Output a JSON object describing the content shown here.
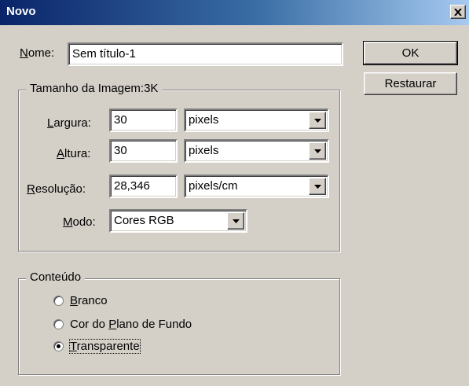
{
  "window": {
    "title": "Novo",
    "close_label": "close"
  },
  "name": {
    "label_pre": "",
    "label_u": "N",
    "label_rest": "ome:",
    "value": "Sem título-1"
  },
  "image_size": {
    "legend": "Tamanho da Imagem:3K",
    "width": {
      "label_u": "L",
      "label_rest": "argura:",
      "value": "30",
      "unit": "pixels"
    },
    "height": {
      "label_u": "A",
      "label_rest": "ltura:",
      "value": "30",
      "unit": "pixels"
    },
    "resolution": {
      "label_u": "R",
      "label_rest": "esolução:",
      "value": "28,346",
      "unit": "pixels/cm"
    },
    "mode": {
      "label_u": "M",
      "label_rest": "odo:",
      "value": "Cores RGB"
    }
  },
  "content": {
    "legend": "Conteúdo",
    "options": [
      {
        "pre": "",
        "u": "B",
        "rest": "ranco",
        "selected": false
      },
      {
        "pre": "Cor do ",
        "u": "P",
        "rest": "lano de Fundo",
        "selected": false
      },
      {
        "pre": "",
        "u": "T",
        "rest": "ransparente",
        "selected": true
      }
    ]
  },
  "buttons": {
    "ok": "OK",
    "reset": "Restaurar"
  },
  "icons": {
    "close": "close-icon",
    "dropdown": "chevron-down-icon"
  }
}
